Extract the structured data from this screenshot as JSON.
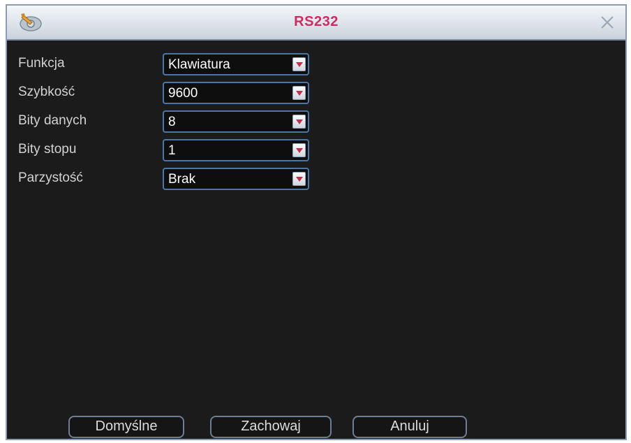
{
  "window": {
    "title": "RS232",
    "logo_icon": "wrench-settings-icon",
    "close_icon": "close-icon"
  },
  "form": {
    "rows": [
      {
        "label": "Funkcja",
        "value": "Klawiatura"
      },
      {
        "label": "Szybkość",
        "value": "9600"
      },
      {
        "label": "Bity danych",
        "value": "8"
      },
      {
        "label": "Bity stopu",
        "value": "1"
      },
      {
        "label": "Parzystość",
        "value": "Brak"
      }
    ]
  },
  "buttons": {
    "default_label": "Domyślne",
    "save_label": "Zachowaj",
    "cancel_label": "Anuluj"
  },
  "colors": {
    "title_text": "#cf2a63",
    "background": "#1b1b1b",
    "field_border": "#4a77a8",
    "label_text": "#d2d2d2"
  }
}
